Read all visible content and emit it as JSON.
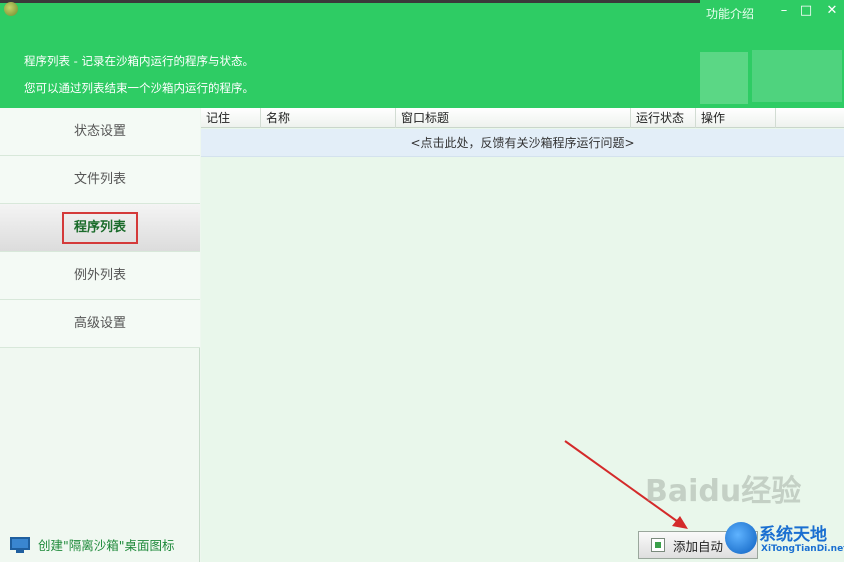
{
  "window": {
    "feature_link": "功能介绍",
    "minimize": "–",
    "maximize": "□",
    "close": "✕"
  },
  "header": {
    "line1": "程序列表 - 记录在沙箱内运行的程序与状态。",
    "line2": "您可以通过列表结束一个沙箱内运行的程序。"
  },
  "sidebar": {
    "items": [
      {
        "label": "状态设置"
      },
      {
        "label": "文件列表"
      },
      {
        "label": "程序列表",
        "active": true
      },
      {
        "label": "例外列表"
      },
      {
        "label": "高级设置"
      }
    ],
    "shortcut_label": "创建\"隔离沙箱\"桌面图标"
  },
  "table": {
    "columns": [
      "记住",
      "名称",
      "窗口标题",
      "运行状态",
      "操作"
    ],
    "feedback_text": "<点击此处，反馈有关沙箱程序运行问题>"
  },
  "footer": {
    "add_button_label": "添加自动"
  },
  "watermarks": {
    "baidu": "Baidu经验",
    "brand": "系统天地",
    "url": "XiTongTianDi.net"
  },
  "colors": {
    "header_green": "#2ecc64",
    "highlight_red": "#d43a3a"
  }
}
